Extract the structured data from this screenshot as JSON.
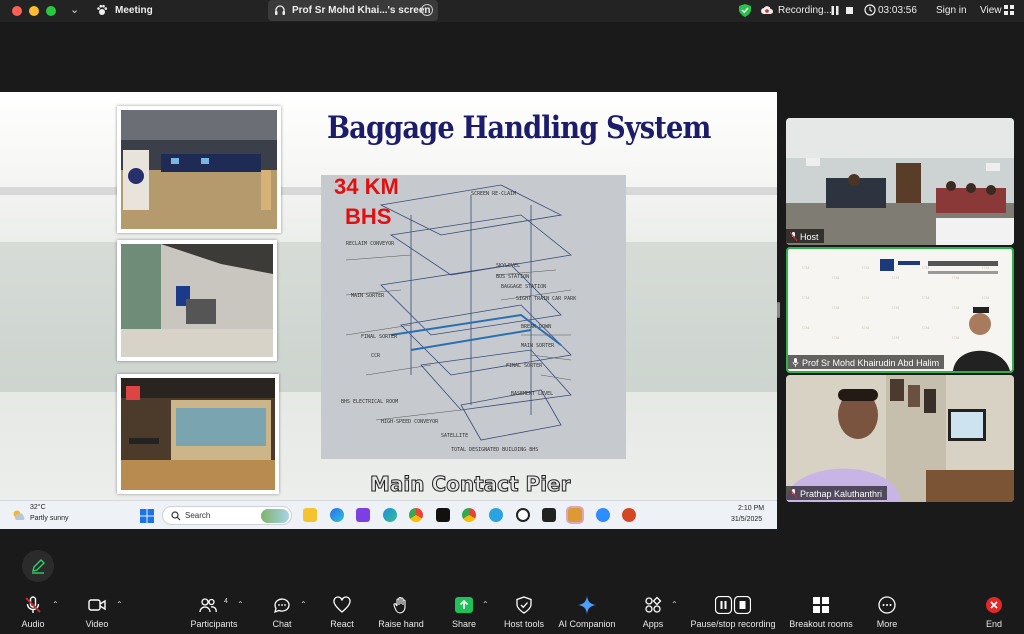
{
  "titlebar": {
    "app_title": "Meeting",
    "share_label": "Prof Sr Mohd Khai...'s screen",
    "recording_label": "Recording...",
    "timer": "03:03:56",
    "signin": "Sign in",
    "view": "View"
  },
  "slide": {
    "title": "Baggage Handling System",
    "bhs_line1": "34 KM",
    "bhs_line2": "BHS",
    "caption": "Main Contact Pier"
  },
  "taskbar": {
    "temperature": "32°C",
    "condition": "Partly sunny",
    "search": "Search",
    "time": "2:10 PM",
    "date": "31/5/2025"
  },
  "participants": [
    {
      "name": "Host"
    },
    {
      "name": "Prof Sr Mohd Khairudin Abd Halim"
    },
    {
      "name": "Prathap Kaluthanthri"
    }
  ],
  "toolbar": {
    "audio": "Audio",
    "video": "Video",
    "participants": "Participants",
    "participants_count": "4",
    "chat": "Chat",
    "react": "React",
    "raise_hand": "Raise hand",
    "share": "Share",
    "host_tools": "Host tools",
    "ai_companion": "AI Companion",
    "apps": "Apps",
    "pause_stop_recording": "Pause/stop recording",
    "breakout_rooms": "Breakout rooms",
    "more": "More",
    "end": "End"
  },
  "colors": {
    "slide_title": "#1c1c6b",
    "bhs_red": "#e01010",
    "active_speaker": "#2fb24d",
    "end_red": "#e02828",
    "share_green": "#1fbf5a"
  }
}
